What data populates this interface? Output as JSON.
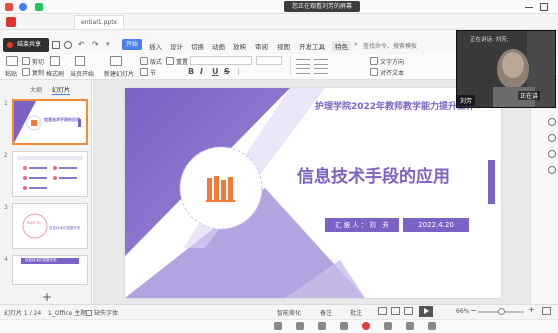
{
  "colors": {
    "accent": "#4c7ff0",
    "slide_purple": "#7b62c4",
    "slide_purple_light": "#a694dc",
    "slide_orange": "#f07a3a",
    "stop_red": "#e53935"
  },
  "notice": "您正在观看刘芳的屏幕",
  "window": {
    "file_tab": "ential1.pptx"
  },
  "share": {
    "stop_label": "结束共享"
  },
  "ribbon": {
    "tabs": [
      "文件",
      "开始",
      "插入",
      "设计",
      "切换",
      "动画",
      "放映",
      "审阅",
      "视图",
      "开发工具",
      "特色"
    ],
    "active_tab": "开始",
    "search": "查找命令、搜索模板",
    "tools": {
      "cut": "剪切",
      "copy": "复制",
      "paste": "粘贴",
      "format_painter": "格式刷",
      "from_current": "当页开始",
      "new_slide": "新建幻灯片",
      "layout": "版式",
      "section": "节",
      "reset": "重置",
      "text_direction": "文字方向",
      "align_text": "对齐文本"
    },
    "format_buttons": [
      "B",
      "I",
      "U",
      "S"
    ]
  },
  "left_panel": {
    "tabs": [
      "大纲",
      "幻灯片"
    ],
    "selected_tab": "幻灯片",
    "slide_numbers": [
      "1",
      "2",
      "3",
      "4"
    ],
    "thumb1_title": "信息技术手段的应用",
    "thumb3_part": "PART 01",
    "thumb3_title": "信息技术的重要作用",
    "thumb4_title": "信息技术的重要作用",
    "add_label": "+"
  },
  "slide": {
    "header": "护理学院2022年教师教学能力提升工作",
    "title": "信息技术手段的应用",
    "reporter": "汇 报 人 ： 刘　芳",
    "date": "2022.4.20"
  },
  "video": {
    "speaking_label": "正在讲话: 刘芳;",
    "speaker_badge": "刘芳",
    "speaking_tag": "正在讲"
  },
  "status": {
    "slide_info": "幻灯片 1 / 24",
    "theme": "1_Office 主题",
    "font_missing": "缺失字体",
    "smart_beautify": "智能美化",
    "notes": "备注",
    "comments": "批注",
    "zoom": "66%"
  }
}
